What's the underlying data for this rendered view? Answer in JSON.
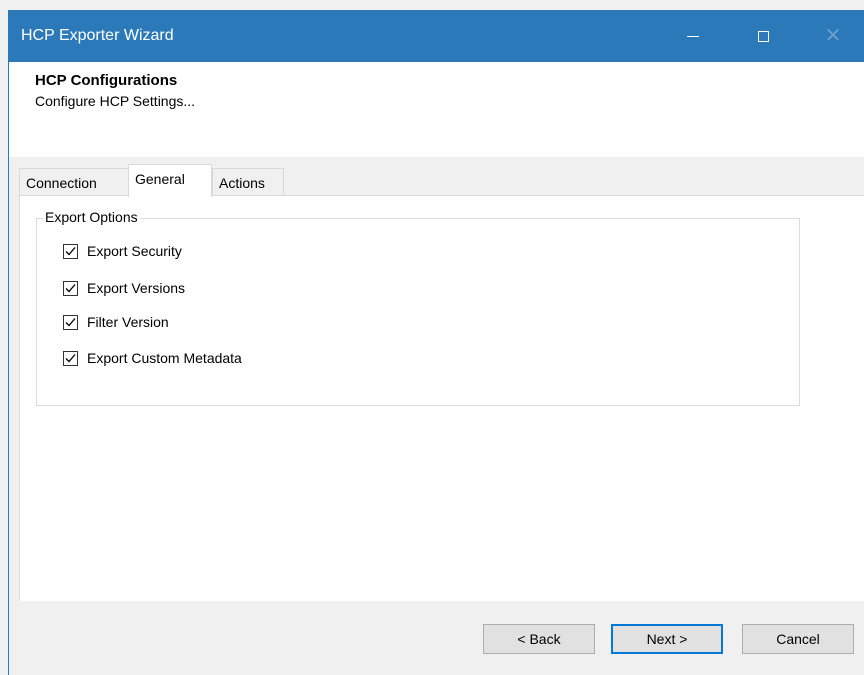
{
  "window": {
    "title": "HCP Exporter Wizard"
  },
  "header": {
    "title": "HCP Configurations",
    "subtitle": "Configure HCP Settings..."
  },
  "tabs": [
    {
      "label": "Connection",
      "active": false
    },
    {
      "label": "General",
      "active": true
    },
    {
      "label": "Actions",
      "active": false
    }
  ],
  "export_options": {
    "legend": "Export Options",
    "items": [
      {
        "label": "Export Security",
        "checked": true
      },
      {
        "label": "Export Versions",
        "checked": true
      },
      {
        "label": "Filter Version",
        "checked": true
      },
      {
        "label": "Export Custom Metadata",
        "checked": true
      }
    ]
  },
  "buttons": {
    "back": "< Back",
    "next": "Next >",
    "cancel": "Cancel"
  },
  "colors": {
    "titlebar": "#2b79b9",
    "focus_border": "#0078d7"
  },
  "icons": {
    "minimize": "minimize-icon",
    "maximize": "maximize-icon",
    "close": "close-icon",
    "check": "checkmark-icon"
  }
}
